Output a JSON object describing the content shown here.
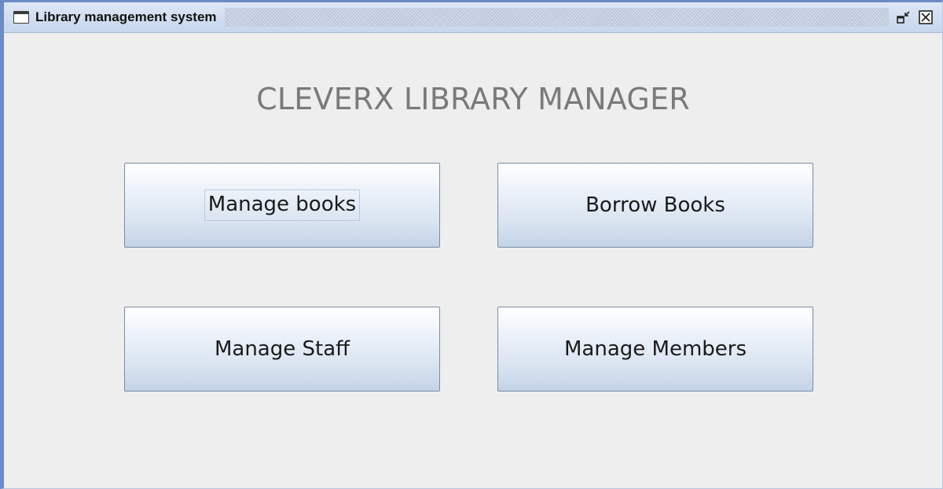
{
  "window": {
    "title": "Library management system",
    "app_icon": "window-icon",
    "controls": {
      "restore_icon": "restore-icon",
      "close_icon": "close-icon"
    }
  },
  "main": {
    "heading": "CLEVERX LIBRARY MANAGER",
    "buttons": {
      "manage_books": "Manage books",
      "borrow_books": "Borrow Books",
      "manage_staff": "Manage Staff",
      "manage_members": "Manage Members"
    }
  },
  "colors": {
    "title_bar": "#c7d6ec",
    "window_border": "#6b8bc4",
    "background": "#eeeeee",
    "heading_text": "#7a7a7a"
  }
}
